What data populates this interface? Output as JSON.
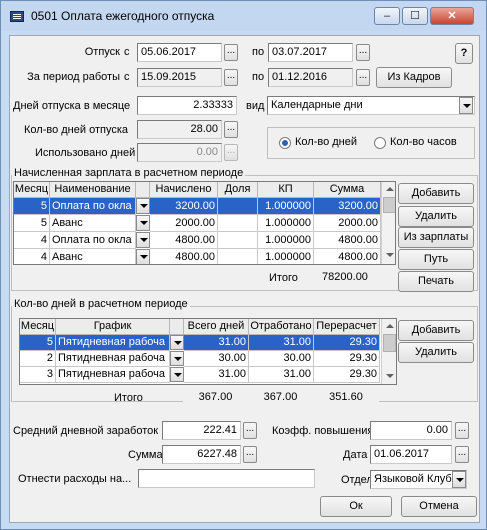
{
  "window": {
    "title": "0501 Оплата ежегодного отпуска",
    "help_label": "?",
    "minimize": "–",
    "maximize": "☐",
    "close": "✕"
  },
  "header": {
    "vacation_label": "Отпуск",
    "from": "с",
    "to": "по",
    "vacation_from": "05.06.2017",
    "vacation_to": "03.07.2017",
    "work_period_label": "За период работы",
    "work_from": "15.09.2015",
    "work_to": "01.12.2016",
    "from_staff_label": "Из Кадров",
    "dots": "..."
  },
  "params": {
    "days_per_month_label": "Дней отпуска в месяце",
    "days_per_month": "2.33333",
    "kind_label": "вид",
    "kind_value": "Календарные дни",
    "vacation_days_label": "Кол-во дней отпуска",
    "vacation_days": "28.00",
    "used_days_label": "Использовано дней",
    "used_days": "0.00",
    "radio_days": "Кол-во дней",
    "radio_hours": "Кол-во часов"
  },
  "salary": {
    "title": "Начисленная зарплата в расчетном периоде",
    "columns": [
      "Месяц",
      "Наименование",
      "Начислено",
      "Доля",
      "КП",
      "Сумма"
    ],
    "rows": [
      {
        "month": "5",
        "name": "Оплата по окла",
        "accrued": "3200.00",
        "share": "",
        "kp": "1.000000",
        "sum": "3200.00"
      },
      {
        "month": "5",
        "name": "Аванс",
        "accrued": "2000.00",
        "share": "",
        "kp": "1.000000",
        "sum": "2000.00"
      },
      {
        "month": "4",
        "name": "Оплата по окла",
        "accrued": "4800.00",
        "share": "",
        "kp": "1.000000",
        "sum": "4800.00"
      },
      {
        "month": "4",
        "name": "Аванс",
        "accrued": "4800.00",
        "share": "",
        "kp": "1.000000",
        "sum": "4800.00"
      }
    ],
    "total_label": "Итого",
    "total": "78200.00",
    "buttons": {
      "add": "Добавить",
      "delete": "Удалить",
      "from_salary": "Из зарплаты",
      "path": "Путь",
      "print": "Печать"
    }
  },
  "days": {
    "title": "Кол-во дней в расчетном периоде",
    "columns": [
      "Месяц",
      "График",
      "Всего дней",
      "Отработано",
      "Перерасчет"
    ],
    "rows": [
      {
        "month": "5",
        "schedule": "Пятидневная рабоча",
        "total": "31.00",
        "worked": "31.00",
        "recalc": "29.30"
      },
      {
        "month": "2",
        "schedule": "Пятидневная рабоча",
        "total": "30.00",
        "worked": "30.00",
        "recalc": "29.30"
      },
      {
        "month": "3",
        "schedule": "Пятидневная рабоча",
        "total": "31.00",
        "worked": "31.00",
        "recalc": "29.30"
      }
    ],
    "total_label": "Итого",
    "total_days": "367.00",
    "total_worked": "367.00",
    "total_recalc": "351.60",
    "buttons": {
      "add": "Добавить",
      "delete": "Удалить"
    }
  },
  "footer": {
    "avg_label": "Средний дневной заработок",
    "avg_value": "222.41",
    "coef_label": "Коэфф. повышения",
    "coef_value": "0.00",
    "sum_label": "Сумма",
    "sum_value": "6227.48",
    "date_label": "Дата",
    "date_value": "01.06.2017",
    "expense_label": "Отнести расходы на...",
    "expense_value": "",
    "dept_label": "Отдел",
    "dept_value": "Языковой Клуб",
    "ok": "Ок",
    "cancel": "Отмена"
  },
  "colors": {
    "selection": "#2a63c8",
    "frame": "#c6daf2"
  }
}
